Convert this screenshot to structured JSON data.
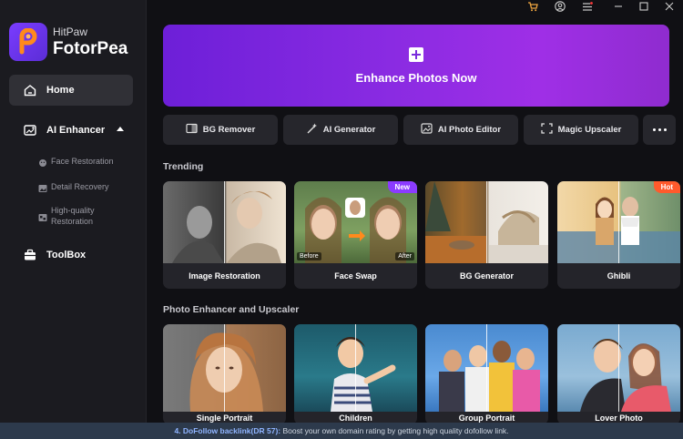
{
  "app": {
    "brand_small": "HitPaw",
    "brand_big": "FotorPea"
  },
  "sidebar": {
    "home": "Home",
    "ai_enhancer": "AI Enhancer",
    "sub_items": [
      "Face Restoration",
      "Detail Recovery",
      "High-quality Restoration"
    ],
    "toolbox": "ToolBox"
  },
  "hero": {
    "label": "Enhance Photos Now"
  },
  "tools": [
    "BG Remover",
    "AI Generator",
    "AI Photo Editor",
    "Magic Upscaler"
  ],
  "trending": {
    "title": "Trending",
    "cards": [
      {
        "label": "Image Restoration",
        "badge": ""
      },
      {
        "label": "Face Swap",
        "badge": "New",
        "before": "Before",
        "after": "After"
      },
      {
        "label": "BG Generator",
        "badge": ""
      },
      {
        "label": "Ghibli",
        "badge": "Hot"
      }
    ]
  },
  "enhancer": {
    "title": "Photo Enhancer and Upscaler",
    "cards": [
      "Single Portrait",
      "Children",
      "Group Portrait",
      "Lover Photo"
    ]
  },
  "banner": {
    "prefix": "4. DoFollow backlink(DR 57):",
    "text": " Boost your own domain rating by getting high quality dofollow link."
  },
  "colors": {
    "accent": "#8a2be2",
    "new_badge": "#8b3bff",
    "hot_badge": "#ff5a2c",
    "banner_bg": "#2d3a4c"
  }
}
